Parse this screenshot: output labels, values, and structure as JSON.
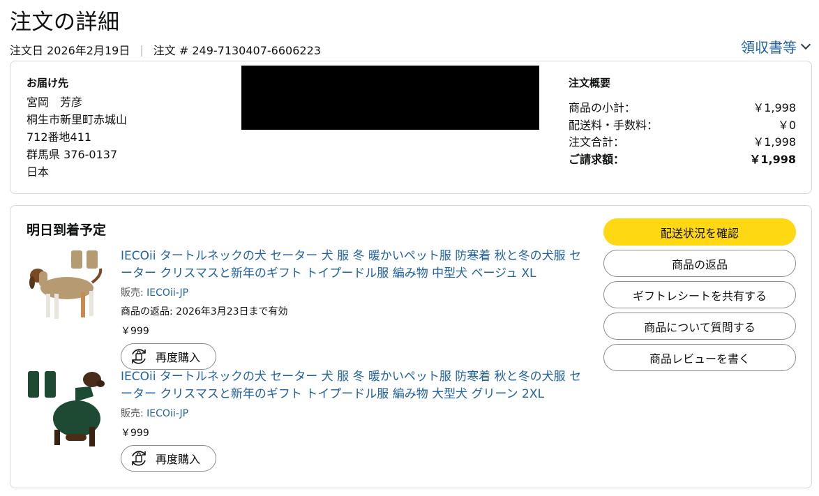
{
  "page": {
    "title": "注文の詳細",
    "order_date": "注文日 2026年2月19日",
    "separator": "|",
    "order_number": "注文 # 249-7130407-6606223",
    "receipt_link": "領収書等"
  },
  "address": {
    "heading": "お届け先",
    "lines": [
      "宮岡　芳彦",
      "桐生市新里町赤城山",
      "712番地411",
      "群馬県 376-0137",
      "日本"
    ]
  },
  "summary": {
    "title": "注文概要",
    "rows": [
      {
        "label": "商品の小計：",
        "value": "￥1,998"
      },
      {
        "label": "配送料・手数料：",
        "value": "￥0"
      },
      {
        "label": "注文合計：",
        "value": "￥1,998"
      },
      {
        "label": "ご請求額：",
        "value": "￥1,998"
      }
    ]
  },
  "shipment": {
    "status": "明日到着予定",
    "items": [
      {
        "title": "IECOii タートルネックの犬 セーター 犬 服 冬 暖かいペット服 防寒着 秋と冬の犬服 セーター クリスマスと新年のギフト トイプードル服 編み物 中型犬 ベージュ XL",
        "seller_label": "販売:",
        "seller": "IECOii-JP",
        "return_info": "商品の返品: 2026年3月23日まで有効",
        "price": "￥999",
        "rebuy_label": "再度購入",
        "color": "#b59a72"
      },
      {
        "title": "IECOii タートルネックの犬 セーター 犬 服 冬 暖かいペット服 防寒着 秋と冬の犬服 セーター クリスマスと新年のギフト トイプードル服 編み物 大型犬 グリーン 2XL",
        "seller_label": "販売:",
        "seller": "IECOii-JP",
        "price": "￥999",
        "rebuy_label": "再度購入",
        "color": "#1e4a34"
      }
    ],
    "actions": {
      "track": "配送状況を確認",
      "return": "商品の返品",
      "gift_receipt": "ギフトレシートを共有する",
      "ask_question": "商品について質問する",
      "write_review": "商品レビューを書く"
    }
  },
  "colors": {
    "link": "#2162a1",
    "primary_button": "#ffd814",
    "border": "#d5d9d9"
  }
}
